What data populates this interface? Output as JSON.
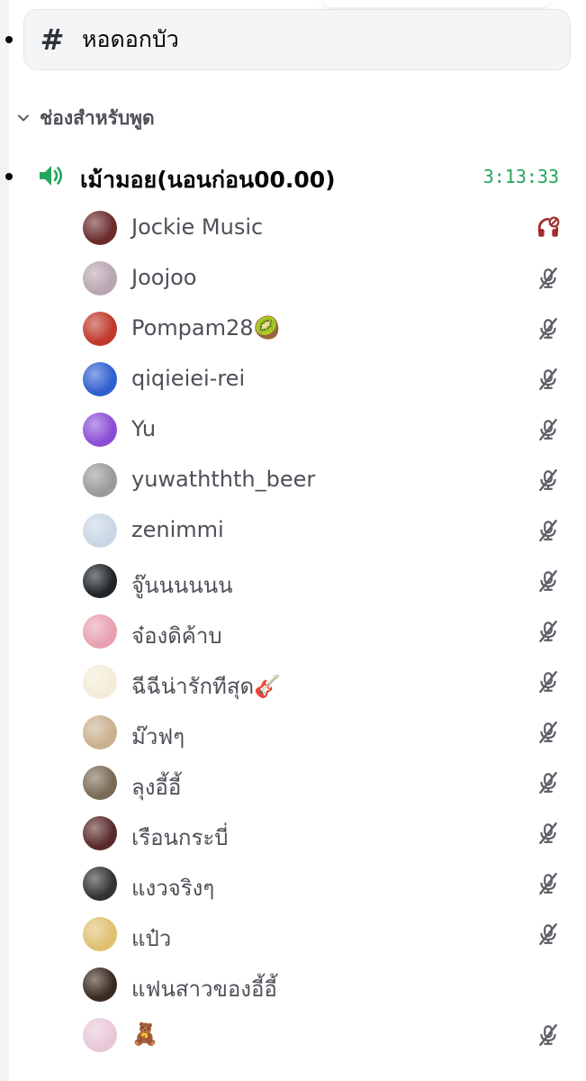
{
  "text_channel": {
    "hash": "#",
    "name": "หอดอกบัว"
  },
  "category": {
    "name": "ช่องสำหรับพูด"
  },
  "voice_channel": {
    "name": "เม้ามอย(นอนก่อน00.00)",
    "timer": "3:13:33"
  },
  "members": [
    {
      "name": "Jockie Music",
      "status": "deafened",
      "avatar": "#6b2b2b"
    },
    {
      "name": "Joojoo",
      "status": "muted",
      "avatar": "#b8a6b0"
    },
    {
      "name": "Pompam28🥝",
      "status": "muted",
      "avatar": "#c0392b"
    },
    {
      "name": "qiqieiei-rei",
      "status": "muted",
      "avatar": "#2f5fd0"
    },
    {
      "name": "Yu",
      "status": "muted",
      "avatar": "#8b4dd6"
    },
    {
      "name": "yuwaththth_beer",
      "status": "muted",
      "avatar": "#9a9a9a"
    },
    {
      "name": "zenimmi",
      "status": "muted",
      "avatar": "#c9d6e6"
    },
    {
      "name": "จู๊นนนนนน",
      "status": "muted",
      "avatar": "#1f2428"
    },
    {
      "name": "จ๋องดิค้าบ",
      "status": "muted",
      "avatar": "#e8a0b0"
    },
    {
      "name": "ฉีฉีน่ารักทีสุด🎸",
      "status": "muted",
      "avatar": "#f4ecd8"
    },
    {
      "name": "ม๊วฟๆ",
      "status": "muted",
      "avatar": "#c9b08f"
    },
    {
      "name": "ลุงอี้อี้",
      "status": "muted",
      "avatar": "#7a6a55"
    },
    {
      "name": "เรือนกระบี่",
      "status": "muted",
      "avatar": "#5a2a2a"
    },
    {
      "name": "แงวจริงๆ",
      "status": "muted",
      "avatar": "#333333"
    },
    {
      "name": "แป๋ว",
      "status": "muted",
      "avatar": "#e0c070"
    },
    {
      "name": "แฟนสาวของอี้อี้",
      "status": "none",
      "avatar": "#3a2a1f"
    },
    {
      "name": "🧸",
      "status": "muted",
      "avatar": "#e8c8d8"
    }
  ],
  "colors": {
    "accent_green": "#23a55a",
    "muted_icon": "#5c5e66",
    "deafened_red": "#a12d2f"
  }
}
